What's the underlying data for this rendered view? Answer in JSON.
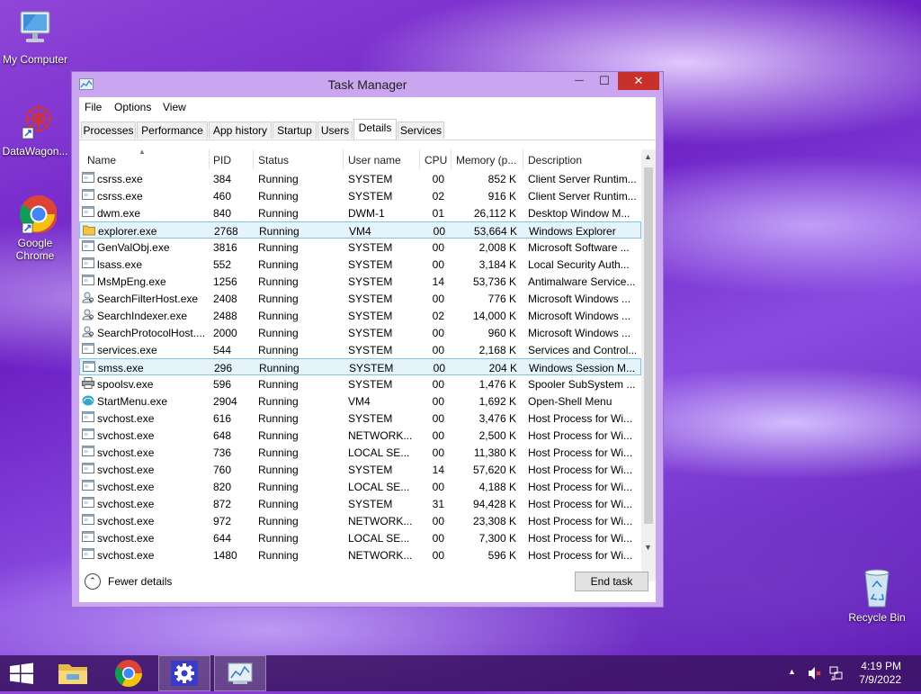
{
  "desktop": {
    "icons": [
      {
        "label": "My Computer"
      },
      {
        "label": "DataWagon..."
      },
      {
        "label": "Google Chrome"
      },
      {
        "label": "Recycle Bin"
      }
    ]
  },
  "window": {
    "title": "Task Manager",
    "buttons": {
      "minimize": "—",
      "maximize": "☐",
      "close": "✕"
    },
    "menu": [
      "File",
      "Options",
      "View"
    ],
    "tabs": [
      "Processes",
      "Performance",
      "App history",
      "Startup",
      "Users",
      "Details",
      "Services"
    ],
    "active_tab": "Details",
    "columns": [
      "Name",
      "PID",
      "Status",
      "User name",
      "CPU",
      "Memory (p...",
      "Description"
    ],
    "rows": [
      {
        "name": "csrss.exe",
        "pid": "384",
        "status": "Running",
        "user": "SYSTEM",
        "cpu": "00",
        "mem": "852 K",
        "desc": "Client Server Runtim...",
        "icon": "generic-exe-icon"
      },
      {
        "name": "csrss.exe",
        "pid": "460",
        "status": "Running",
        "user": "SYSTEM",
        "cpu": "02",
        "mem": "916 K",
        "desc": "Client Server Runtim...",
        "icon": "generic-exe-icon"
      },
      {
        "name": "dwm.exe",
        "pid": "840",
        "status": "Running",
        "user": "DWM-1",
        "cpu": "01",
        "mem": "26,112 K",
        "desc": "Desktop Window M...",
        "icon": "generic-exe-icon"
      },
      {
        "name": "explorer.exe",
        "pid": "2768",
        "status": "Running",
        "user": "VM4",
        "cpu": "00",
        "mem": "53,664 K",
        "desc": "Windows Explorer",
        "icon": "folder-icon",
        "selected": true
      },
      {
        "name": "GenValObj.exe",
        "pid": "3816",
        "status": "Running",
        "user": "SYSTEM",
        "cpu": "00",
        "mem": "2,008 K",
        "desc": "Microsoft Software ...",
        "icon": "generic-exe-icon"
      },
      {
        "name": "lsass.exe",
        "pid": "552",
        "status": "Running",
        "user": "SYSTEM",
        "cpu": "00",
        "mem": "3,184 K",
        "desc": "Local Security Auth...",
        "icon": "generic-exe-icon"
      },
      {
        "name": "MsMpEng.exe",
        "pid": "1256",
        "status": "Running",
        "user": "SYSTEM",
        "cpu": "14",
        "mem": "53,736 K",
        "desc": "Antimalware Service...",
        "icon": "generic-exe-icon"
      },
      {
        "name": "SearchFilterHost.exe",
        "pid": "2408",
        "status": "Running",
        "user": "SYSTEM",
        "cpu": "00",
        "mem": "776 K",
        "desc": "Microsoft Windows ...",
        "icon": "search-person-icon"
      },
      {
        "name": "SearchIndexer.exe",
        "pid": "2488",
        "status": "Running",
        "user": "SYSTEM",
        "cpu": "02",
        "mem": "14,000 K",
        "desc": "Microsoft Windows ...",
        "icon": "search-person-icon"
      },
      {
        "name": "SearchProtocolHost....",
        "pid": "2000",
        "status": "Running",
        "user": "SYSTEM",
        "cpu": "00",
        "mem": "960 K",
        "desc": "Microsoft Windows ...",
        "icon": "search-person-icon"
      },
      {
        "name": "services.exe",
        "pid": "544",
        "status": "Running",
        "user": "SYSTEM",
        "cpu": "00",
        "mem": "2,168 K",
        "desc": "Services and Control...",
        "icon": "generic-exe-icon"
      },
      {
        "name": "smss.exe",
        "pid": "296",
        "status": "Running",
        "user": "SYSTEM",
        "cpu": "00",
        "mem": "204 K",
        "desc": "Windows Session M...",
        "icon": "generic-exe-icon",
        "selected": true
      },
      {
        "name": "spoolsv.exe",
        "pid": "596",
        "status": "Running",
        "user": "SYSTEM",
        "cpu": "00",
        "mem": "1,476 K",
        "desc": "Spooler SubSystem ...",
        "icon": "printer-icon"
      },
      {
        "name": "StartMenu.exe",
        "pid": "2904",
        "status": "Running",
        "user": "VM4",
        "cpu": "00",
        "mem": "1,692 K",
        "desc": "Open-Shell Menu",
        "icon": "shell-icon"
      },
      {
        "name": "svchost.exe",
        "pid": "616",
        "status": "Running",
        "user": "SYSTEM",
        "cpu": "00",
        "mem": "3,476 K",
        "desc": "Host Process for Wi...",
        "icon": "generic-exe-icon"
      },
      {
        "name": "svchost.exe",
        "pid": "648",
        "status": "Running",
        "user": "NETWORK...",
        "cpu": "00",
        "mem": "2,500 K",
        "desc": "Host Process for Wi...",
        "icon": "generic-exe-icon"
      },
      {
        "name": "svchost.exe",
        "pid": "736",
        "status": "Running",
        "user": "LOCAL SE...",
        "cpu": "00",
        "mem": "11,380 K",
        "desc": "Host Process for Wi...",
        "icon": "generic-exe-icon"
      },
      {
        "name": "svchost.exe",
        "pid": "760",
        "status": "Running",
        "user": "SYSTEM",
        "cpu": "14",
        "mem": "57,620 K",
        "desc": "Host Process for Wi...",
        "icon": "generic-exe-icon"
      },
      {
        "name": "svchost.exe",
        "pid": "820",
        "status": "Running",
        "user": "LOCAL SE...",
        "cpu": "00",
        "mem": "4,188 K",
        "desc": "Host Process for Wi...",
        "icon": "generic-exe-icon"
      },
      {
        "name": "svchost.exe",
        "pid": "872",
        "status": "Running",
        "user": "SYSTEM",
        "cpu": "31",
        "mem": "94,428 K",
        "desc": "Host Process for Wi...",
        "icon": "generic-exe-icon"
      },
      {
        "name": "svchost.exe",
        "pid": "972",
        "status": "Running",
        "user": "NETWORK...",
        "cpu": "00",
        "mem": "23,308 K",
        "desc": "Host Process for Wi...",
        "icon": "generic-exe-icon"
      },
      {
        "name": "svchost.exe",
        "pid": "644",
        "status": "Running",
        "user": "LOCAL SE...",
        "cpu": "00",
        "mem": "7,300 K",
        "desc": "Host Process for Wi...",
        "icon": "generic-exe-icon"
      },
      {
        "name": "svchost.exe",
        "pid": "1480",
        "status": "Running",
        "user": "NETWORK...",
        "cpu": "00",
        "mem": "596 K",
        "desc": "Host Process for Wi...",
        "icon": "generic-exe-icon"
      }
    ],
    "fewer_details": "Fewer details",
    "end_task": "End task"
  },
  "taskbar": {
    "items": [
      "start-button",
      "file-explorer",
      "google-chrome",
      "settings",
      "task-manager"
    ],
    "time": "4:19 PM",
    "date": "7/9/2022"
  },
  "colors": {
    "selection_bg": "#e5f3fb",
    "selection_border": "#84c3e8",
    "window_frame": "#c9a6ef"
  }
}
